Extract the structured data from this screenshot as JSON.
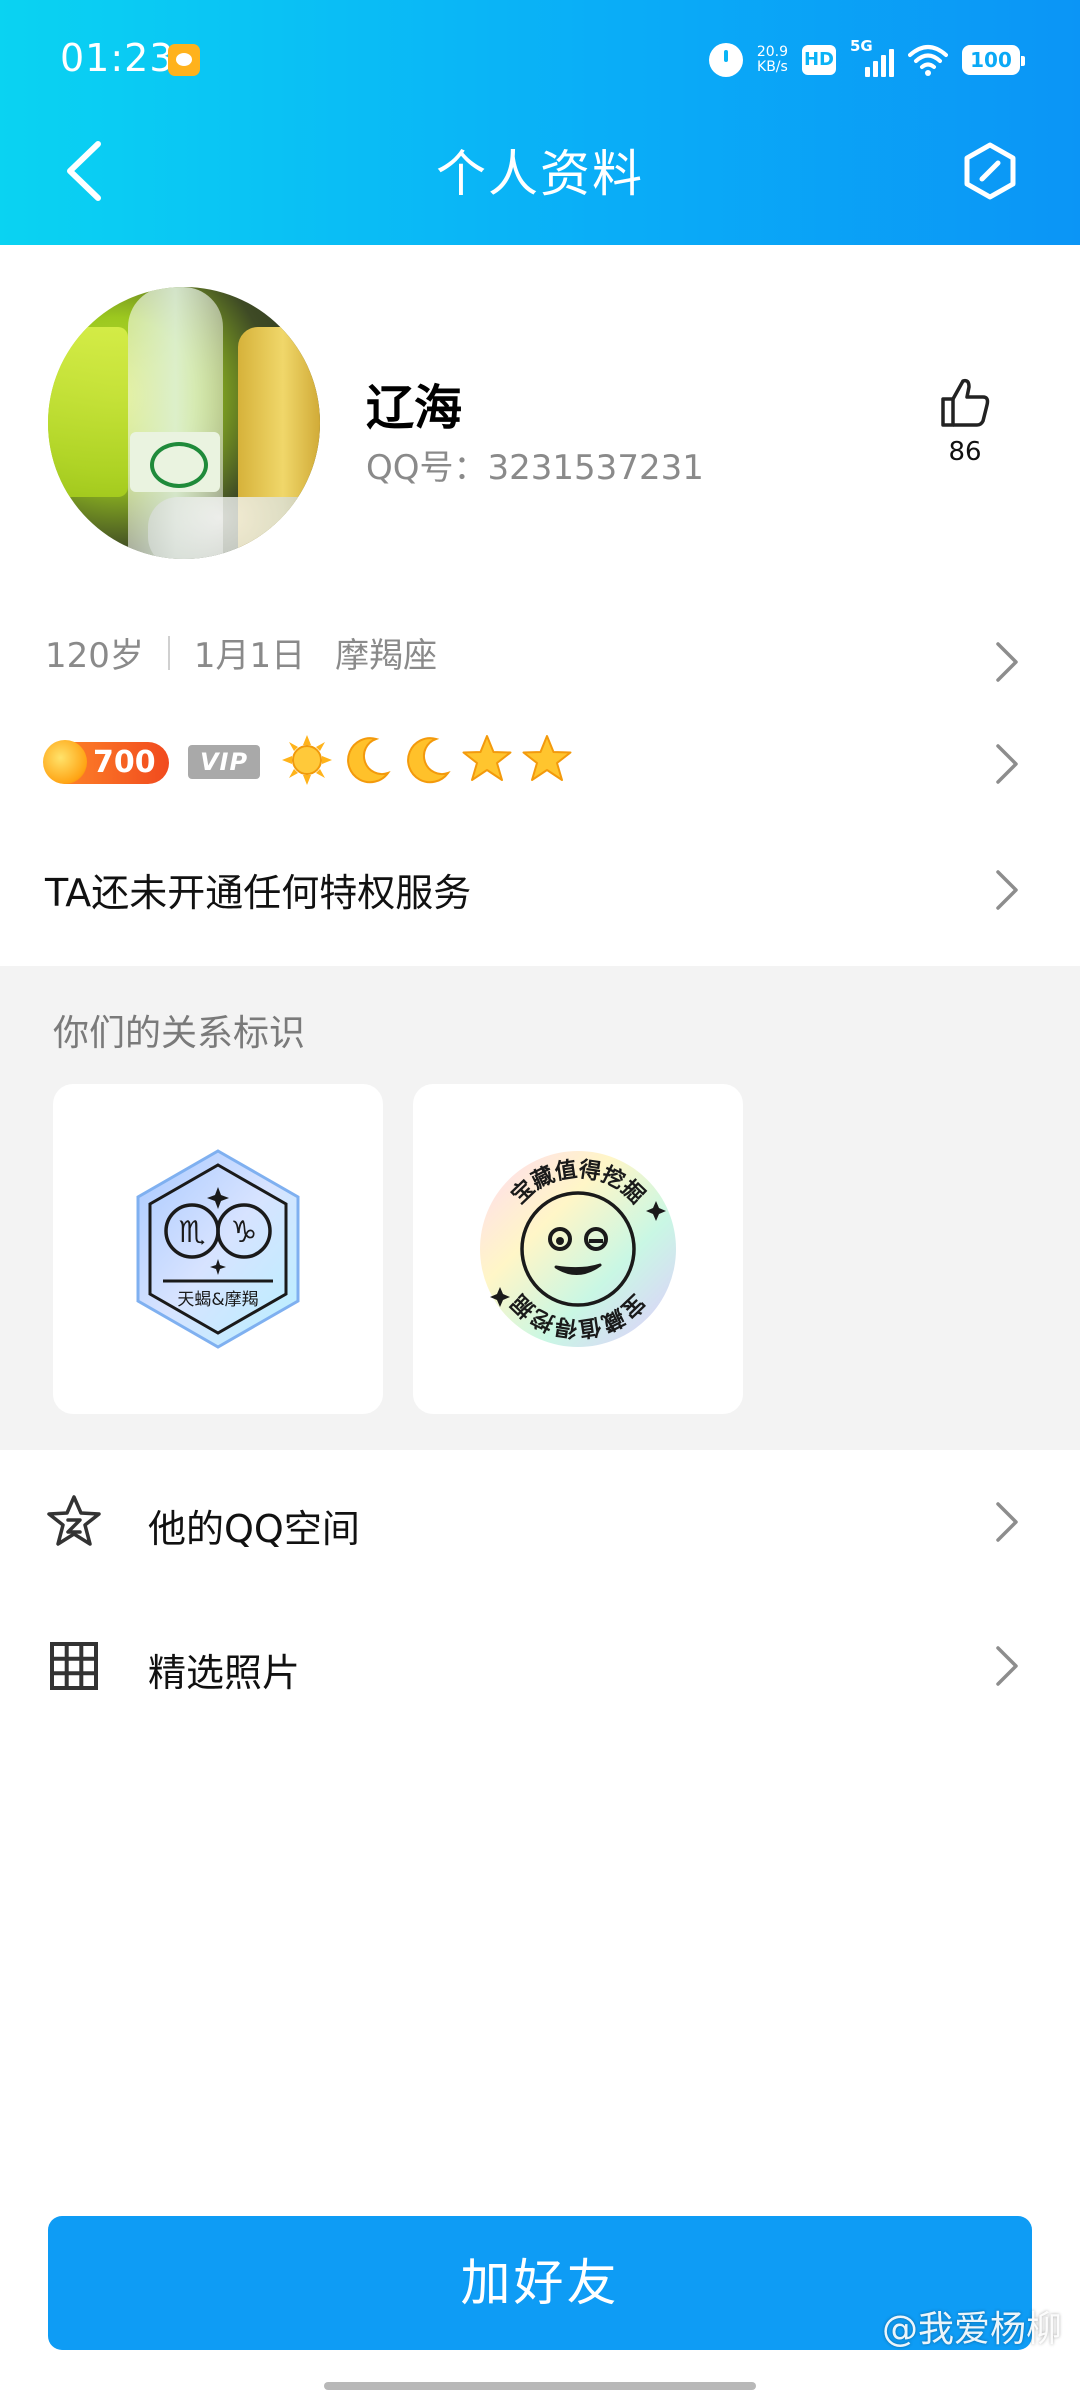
{
  "status_bar": {
    "time": "01:23",
    "net_speed_value": "20.9",
    "net_speed_unit": "KB/s",
    "hd_label": "HD",
    "network_label": "5G",
    "battery": "100"
  },
  "header": {
    "title": "个人资料"
  },
  "profile": {
    "name": "辽海",
    "qq_number": "QQ号：3231537231",
    "likes": "86"
  },
  "info": {
    "age": "120岁",
    "birthday": "1月1日",
    "zodiac": "摩羯座"
  },
  "badges": {
    "level_value": "700",
    "vip_label": "VIP",
    "level_icons": [
      "sun-icon",
      "moon-icon",
      "moon-icon",
      "star-icon",
      "star-icon"
    ]
  },
  "privilege": {
    "text": "TA还未开通任何特权服务"
  },
  "relation": {
    "title": "你们的关系标识",
    "cards": [
      {
        "icon": "zodiac-match-badge-icon",
        "label": "天蝎&摩羯"
      },
      {
        "icon": "treasure-dig-badge-icon",
        "label": "宝藏值得挖掘"
      }
    ]
  },
  "menu": [
    {
      "icon": "qzone-star-icon",
      "label": "他的QQ空间"
    },
    {
      "icon": "photo-grid-icon",
      "label": "精选照片"
    }
  ],
  "add_friend_label": "加好友",
  "watermark": "@我爱杨柳",
  "colors": {
    "header_start": "#0ad3f2",
    "header_end": "#0b95f6",
    "primary_button": "#0e9cf5",
    "section_bg": "#f3f3f3"
  }
}
